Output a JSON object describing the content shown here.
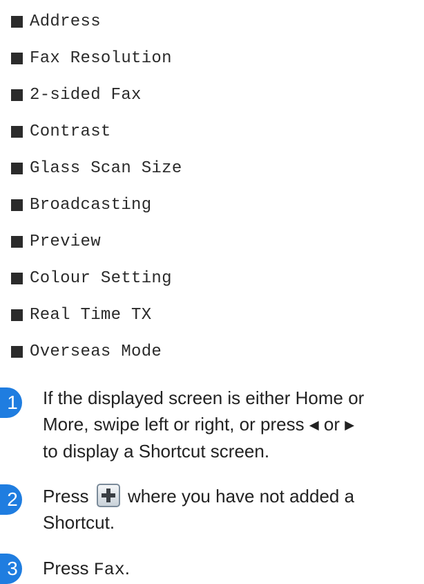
{
  "options": [
    "Address",
    "Fax Resolution",
    "2-sided Fax",
    "Contrast",
    "Glass Scan Size",
    "Broadcasting",
    "Preview",
    "Colour Setting",
    "Real Time TX",
    "Overseas Mode"
  ],
  "steps": [
    {
      "number": "1",
      "line1": "If the displayed screen is either Home or",
      "line2_a": "More, swipe left or right, or press",
      "line2_or": "or",
      "line3": "to display a Shortcut screen.",
      "left_icon": "left-triangle-icon",
      "right_icon": "right-triangle-icon"
    },
    {
      "number": "2",
      "text_a": "Press",
      "text_b": "where you have not added a",
      "line2": "Shortcut.",
      "icon": "add-shortcut-plus-icon"
    },
    {
      "number": "3",
      "text_a": "Press",
      "code": "Fax",
      "text_end": "."
    }
  ],
  "colors": {
    "step_badge": "#1f7de0",
    "bullet": "#2b2b2b"
  }
}
